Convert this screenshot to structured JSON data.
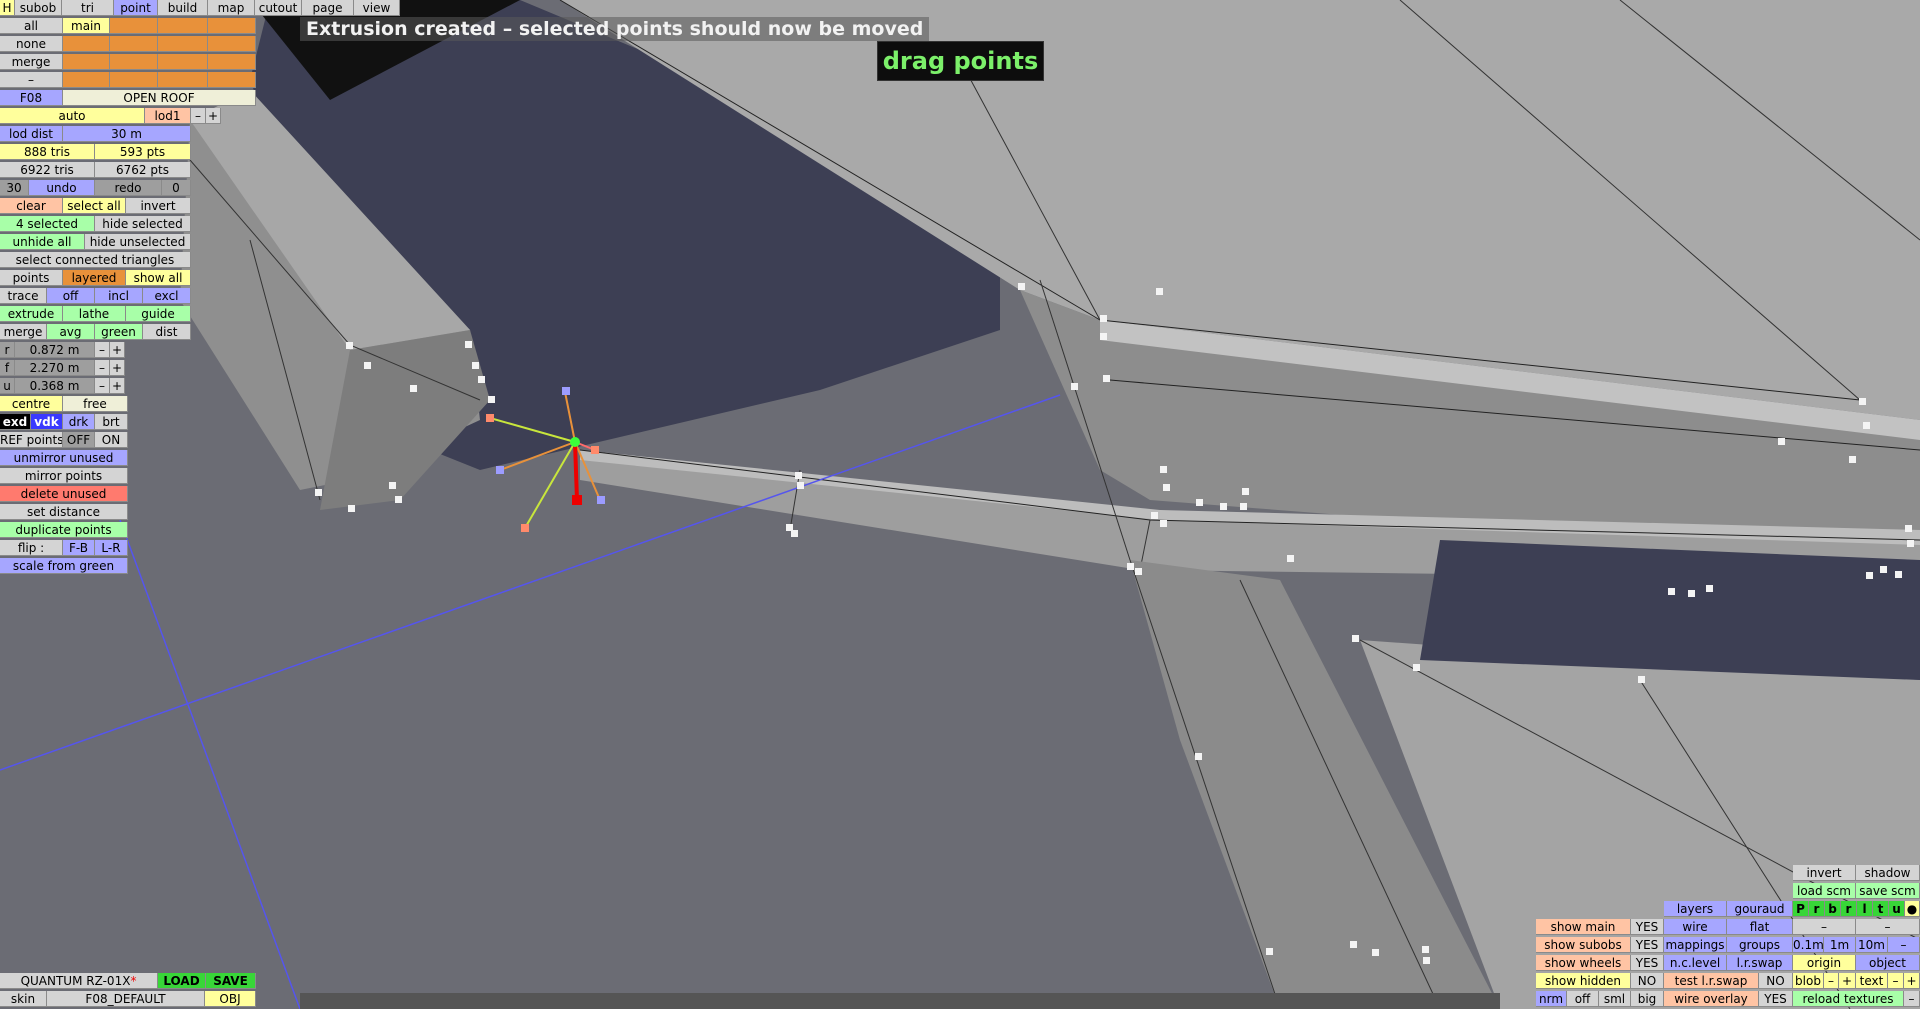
{
  "top_bar": {
    "h": "H",
    "tabs": [
      "subob",
      "tri",
      "point",
      "build",
      "map",
      "cutout",
      "page",
      "view"
    ],
    "active_tab": "point"
  },
  "left_panel": {
    "all": "all",
    "main": "main",
    "none": "none",
    "merge": "merge",
    "dash": "–",
    "f08": "F08",
    "open_roof": "OPEN ROOF",
    "auto": "auto",
    "lod1": "lod1",
    "minus": "–",
    "plus": "+",
    "lod_dist_label": "lod dist",
    "lod_dist_value": "30 m",
    "tris1": "888 tris",
    "pts1": "593 pts",
    "tris2": "6922 tris",
    "pts2": "6762 pts",
    "undo_count": "30",
    "undo": "undo",
    "redo": "redo",
    "redo_count": "0",
    "clear": "clear",
    "select_all": "select all",
    "invert": "invert",
    "selected": "4 selected",
    "hide_selected": "hide selected",
    "unhide_all": "unhide all",
    "hide_unselected": "hide unselected",
    "select_connected": "select connected triangles",
    "points": "points",
    "layered": "layered",
    "show_all": "show all",
    "trace": "trace",
    "off": "off",
    "incl": "incl",
    "excl": "excl",
    "extrude": "extrude",
    "lathe": "lathe",
    "guide": "guide",
    "merge2": "merge",
    "avg": "avg",
    "green": "green",
    "dist": "dist",
    "r_label": "r",
    "r_value": "0.872 m",
    "f_label": "f",
    "f_value": "2.270 m",
    "u_label": "u",
    "u_value": "0.368 m",
    "centre": "centre",
    "free": "free",
    "exd": "exd",
    "vdk": "vdk",
    "drk": "drk",
    "brt": "brt",
    "ref_points": "REF points",
    "ref_off": "OFF",
    "ref_on": "ON",
    "unmirror_unused": "unmirror unused",
    "mirror_points": "mirror points",
    "delete_unused": "delete unused",
    "set_distance": "set distance",
    "duplicate_points": "duplicate points",
    "flip": "flip :",
    "fb": "F-B",
    "lr": "L-R",
    "scale_from_green": "scale from green"
  },
  "bottom_left": {
    "car_name": "QUANTUM RZ-01X",
    "star": "*",
    "load": "LOAD",
    "save": "SAVE",
    "skin": "skin",
    "skin_value": "F08_DEFAULT",
    "obj": "OBJ"
  },
  "messages": {
    "status": "Extrusion created – selected points should now be moved",
    "mode": "drag points"
  },
  "bottom_right": {
    "invert": "invert",
    "shadow": "shadow",
    "load_scm": "load scm",
    "save_scm": "save scm",
    "prb": [
      "P",
      "r",
      "b",
      "r",
      "l",
      "t",
      "u",
      "●"
    ],
    "layers": "layers",
    "gouraud": "gouraud",
    "dash": "–",
    "wire": "wire",
    "flat": "flat",
    "show_main": "show main",
    "show_main_v": "YES",
    "show_subobs": "show subobs",
    "show_subobs_v": "YES",
    "mappings": "mappings",
    "groups": "groups",
    "g01": "0.1m",
    "g1": "1m",
    "g10": "10m",
    "show_wheels": "show wheels",
    "show_wheels_v": "YES",
    "nclevel": "n.c.level",
    "lrswap": "l.r.swap",
    "origin": "origin",
    "object": "object",
    "show_hidden": "show hidden",
    "show_hidden_v": "NO",
    "test_lrswap": "test l.r.swap",
    "test_lrswap_v": "NO",
    "blob": "blob",
    "text": "text",
    "plus": "+",
    "nrm": "nrm",
    "off": "off",
    "sml": "sml",
    "big": "big",
    "wire_overlay": "wire overlay",
    "wire_overlay_v": "YES",
    "reload_textures": "reload textures"
  },
  "colors": {
    "background": "#6b6c74",
    "mesh_grey": "#9a9a9a",
    "dark_bg": "#3d3f54",
    "accent_blue": "#a6a6ff",
    "accent_orange": "#e8913a",
    "mode_text": "#7cf06a"
  }
}
